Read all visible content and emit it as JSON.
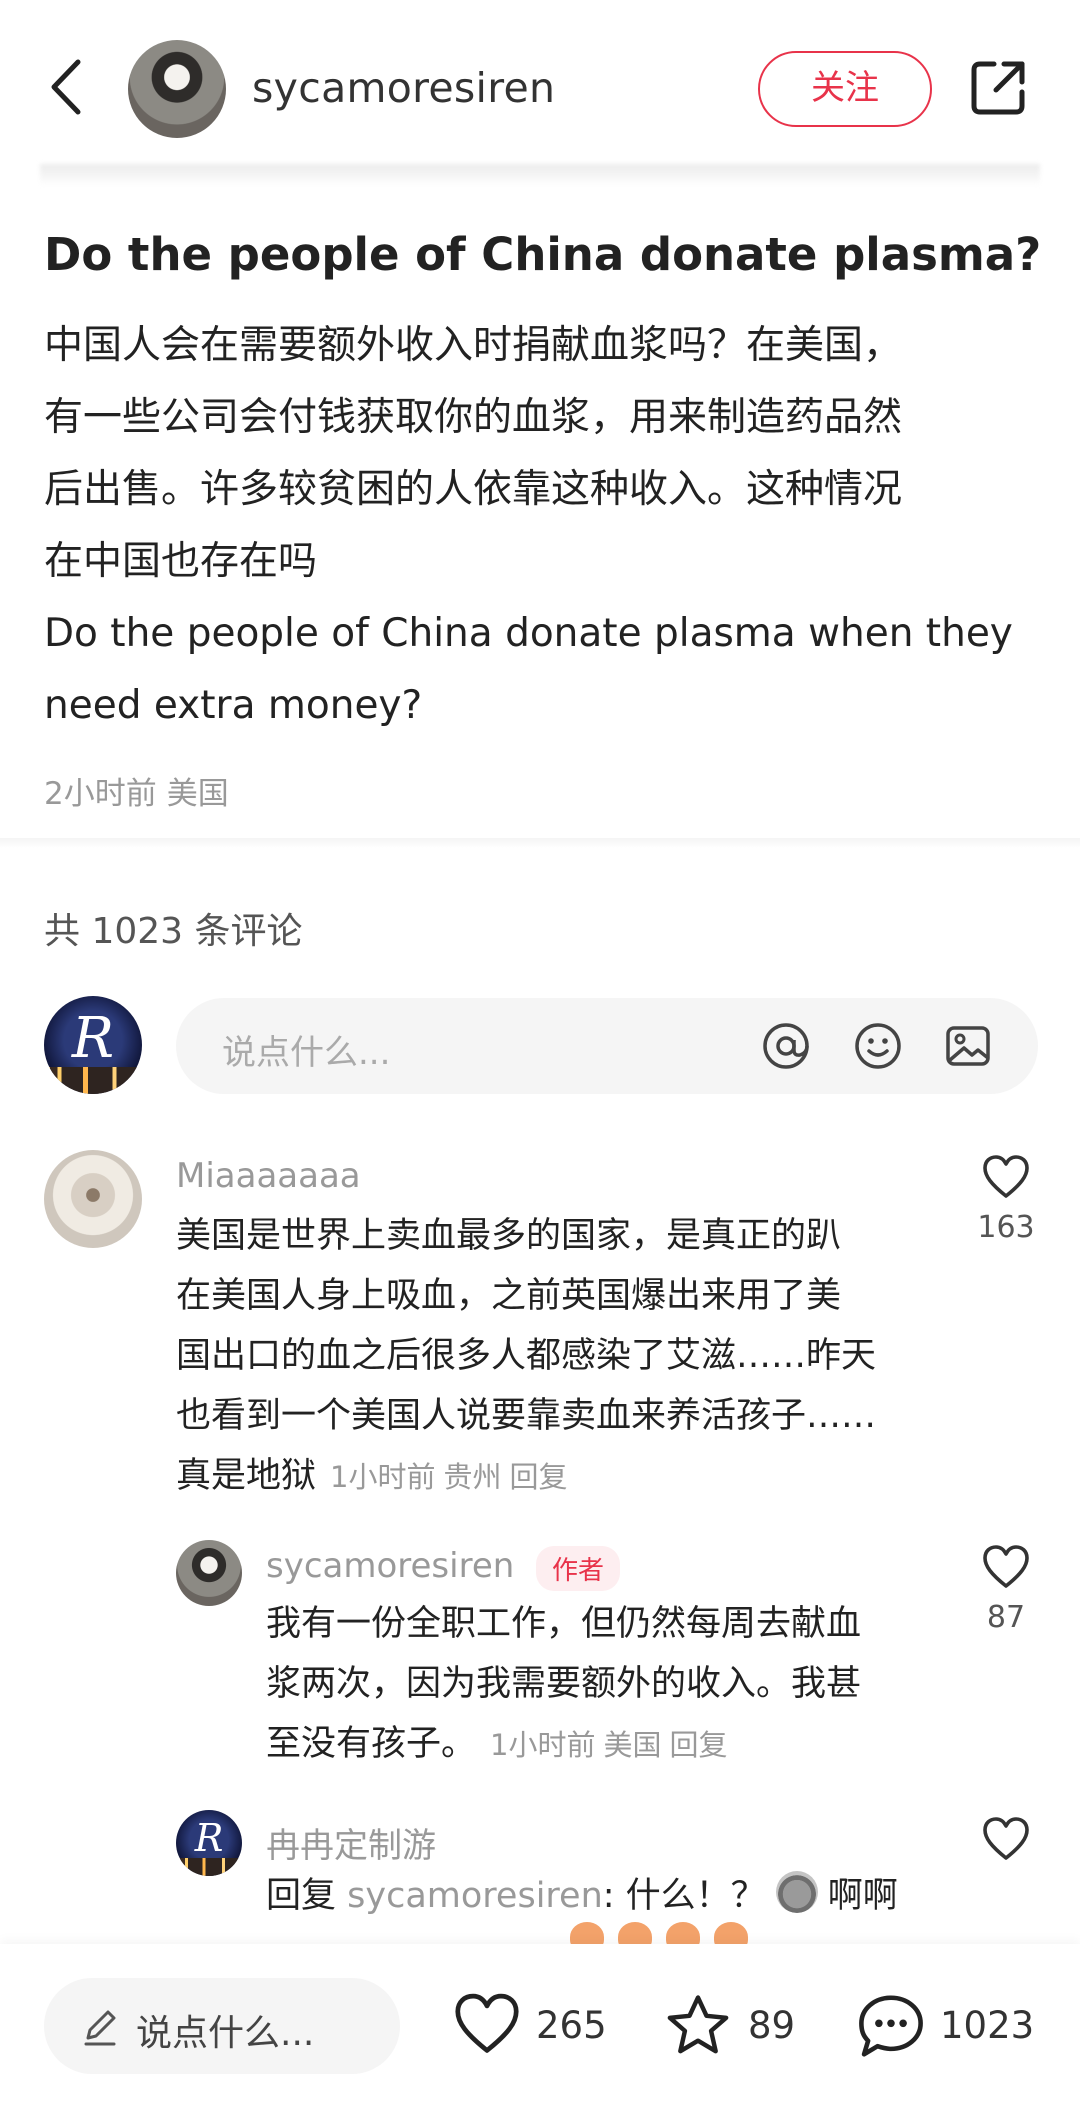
{
  "header": {
    "author_name": "sycamoresiren",
    "follow_label": "关注",
    "back_icon": "chevron-left-icon",
    "share_icon": "share-icon"
  },
  "post": {
    "title": "Do the people of China donate plasma?",
    "body_lines": [
      "中国人会在需要额外收入时捐献血浆吗？在美国，",
      "有一些公司会付钱获取你的血浆，用来制造药品然",
      "后出售。许多较贫困的人依靠这种收入。这种情况",
      "在中国也存在吗",
      "Do the people of China donate plasma when they",
      "need extra money?"
    ],
    "time": "2小时前",
    "location": "美国"
  },
  "comments_header": {
    "count_label": "共 1023 条评论"
  },
  "comment_input": {
    "placeholder": "说点什么...",
    "icons": [
      "at-icon",
      "emoji-icon",
      "image-icon"
    ]
  },
  "comments": [
    {
      "user": "Miaaaaaaa",
      "lines": [
        "美国是世界上卖血最多的国家，是真正的趴",
        "在美国人身上吸血，之前英国爆出来用了美",
        "国出口的血之后很多人都感染了艾滋……昨天",
        "也看到一个美国人说要靠卖血来养活孩子……",
        "真是地狱"
      ],
      "time": "1小时前",
      "location": "贵州",
      "reply": "回复",
      "likes": "163"
    },
    {
      "user": "sycamoresiren",
      "tag": "作者",
      "lines": [
        "我有一份全职工作，但仍然每周去献血",
        "浆两次，因为我需要额外的收入。我甚",
        "至没有孩子。"
      ],
      "time": "1小时前",
      "location": "美国",
      "reply": "回复",
      "likes": "87"
    },
    {
      "user": "冉冉定制游",
      "reply_prefix": "回复",
      "reply_to": "sycamoresiren",
      "text": ": 什么！？",
      "text_after": "啊啊"
    }
  ],
  "bottom_bar": {
    "input_label": "说点什么...",
    "likes": "265",
    "favorites": "89",
    "comments": "1023"
  }
}
